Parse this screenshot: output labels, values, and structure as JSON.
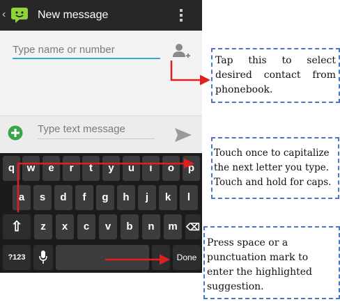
{
  "action_bar": {
    "back": "‹",
    "title": "New message",
    "app_icon": "sms-app-icon",
    "overflow_icon": "overflow-menu-icon"
  },
  "recipient": {
    "placeholder": "Type name or number",
    "add_contact_icon": "add-contact-icon"
  },
  "compose": {
    "placeholder": "Type text message",
    "attach_icon": "add-attachment-icon",
    "send_icon": "send-icon"
  },
  "keyboard": {
    "row1": [
      "q",
      "w",
      "e",
      "r",
      "t",
      "y",
      "u",
      "i",
      "o",
      "p"
    ],
    "row2": [
      "a",
      "s",
      "d",
      "f",
      "g",
      "h",
      "j",
      "k",
      "l"
    ],
    "row3": [
      "z",
      "x",
      "c",
      "v",
      "b",
      "n",
      "m"
    ],
    "shift_label": "⇧",
    "delete_label": "⌫",
    "symbols_label": "?123",
    "mic_icon": "microphone-icon",
    "done_label": "Done"
  },
  "callouts": {
    "contact": "Tap this to select desired contact from phonebook.",
    "shift": "Touch once to capitalize the next letter you type. Touch and hold for caps.",
    "space": "Press space or a punctuation mark to enter the highlighted suggestion."
  },
  "colors": {
    "accent": "#2fa8d8",
    "arrow": "#e02020",
    "callout_border": "#4a78c2",
    "plus_green": "#3aa449"
  }
}
